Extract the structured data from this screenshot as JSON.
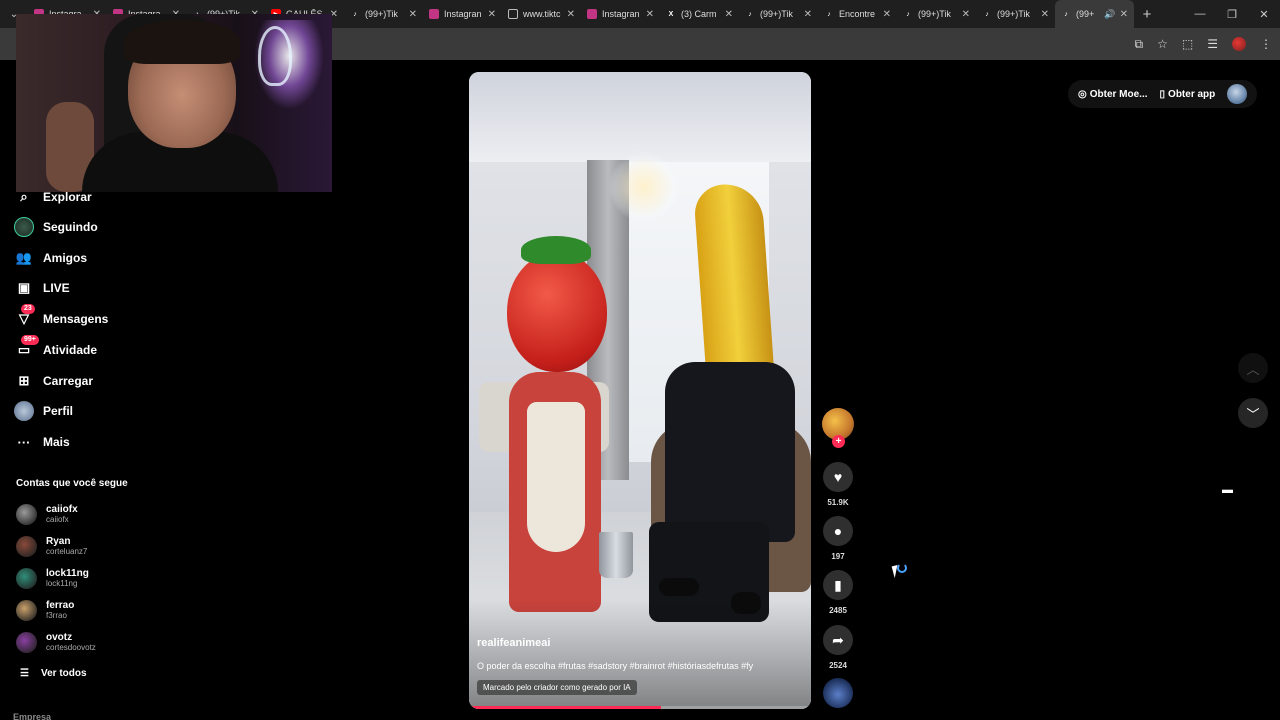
{
  "browser": {
    "tabs": [
      {
        "label": "Instagra",
        "fav": "ig",
        "color": "#c13584"
      },
      {
        "label": "Instagra",
        "fav": "ig",
        "color": "#c13584"
      },
      {
        "label": "(99+)Tik",
        "fav": "tiktok",
        "color": "#ffffff"
      },
      {
        "label": "GAULÊS",
        "fav": "youtube",
        "color": "#ff0000"
      },
      {
        "label": "(99+)Tik",
        "fav": "tiktok",
        "color": "#ffffff"
      },
      {
        "label": "Instagran",
        "fav": "ig",
        "color": "#c13584"
      },
      {
        "label": "www.tiktc",
        "fav": "globe",
        "color": "#bbbbbb"
      },
      {
        "label": "Instagran",
        "fav": "ig",
        "color": "#c13584"
      },
      {
        "label": "(3) Carm",
        "fav": "x",
        "color": "#ffffff"
      },
      {
        "label": "(99+)Tik",
        "fav": "tiktok",
        "color": "#ffffff"
      },
      {
        "label": "Encontre",
        "fav": "tiktok",
        "color": "#ffffff"
      },
      {
        "label": "(99+)Tik",
        "fav": "tiktok",
        "color": "#ffffff"
      },
      {
        "label": "(99+)Tik",
        "fav": "tiktok",
        "color": "#ffffff"
      },
      {
        "label": "(99+",
        "fav": "tiktok",
        "color": "#ffffff",
        "active": true
      }
    ]
  },
  "sidebar": {
    "nav": [
      {
        "label": "Explorar",
        "icon": "compass-icon",
        "glyph": "⌕"
      },
      {
        "label": "Seguindo",
        "icon": "following-icon",
        "glyph": "●"
      },
      {
        "label": "Amigos",
        "icon": "friends-icon",
        "glyph": "👥"
      },
      {
        "label": "LIVE",
        "icon": "live-icon",
        "glyph": "▣"
      },
      {
        "label": "Mensagens",
        "icon": "messages-icon",
        "glyph": "▽",
        "badge": "23"
      },
      {
        "label": "Atividade",
        "icon": "activity-icon",
        "glyph": "▭",
        "badge": "99+"
      },
      {
        "label": "Carregar",
        "icon": "upload-icon",
        "glyph": "⊞"
      },
      {
        "label": "Perfil",
        "icon": "profile-icon",
        "glyph": "●"
      },
      {
        "label": "Mais",
        "icon": "more-icon",
        "glyph": "···"
      }
    ],
    "following_title": "Contas que você segue",
    "accounts": [
      {
        "name": "caiiofx",
        "handle": "caiiofx",
        "color": "#9a9a9a"
      },
      {
        "name": "Ryan",
        "handle": "corteluanz7",
        "color": "#8a4a3a"
      },
      {
        "name": "lock11ng",
        "handle": "lock11ng",
        "color": "#2f8f7a"
      },
      {
        "name": "ferrao",
        "handle": "f3rrao",
        "color": "#c9a06a"
      },
      {
        "name": "ovotz",
        "handle": "cortesdoovotz",
        "color": "#8a3fa0"
      }
    ],
    "see_all": "Ver todos",
    "company": "Empresa"
  },
  "video": {
    "author": "realifeanimeai",
    "caption": "O poder da escolha #frutas #sadstory #brainrot #históriasdefrutas #fy",
    "ai_label": "Marcado pelo criador como gerado por IA",
    "progress": 0.56
  },
  "actions": {
    "likes": "51.9K",
    "comments": "197",
    "saves": "2485",
    "shares": "2524"
  },
  "topbar": {
    "coins": "Obter Moe...",
    "app": "Obter app"
  },
  "colors": {
    "accent": "#fe2c55",
    "background": "#000000"
  }
}
